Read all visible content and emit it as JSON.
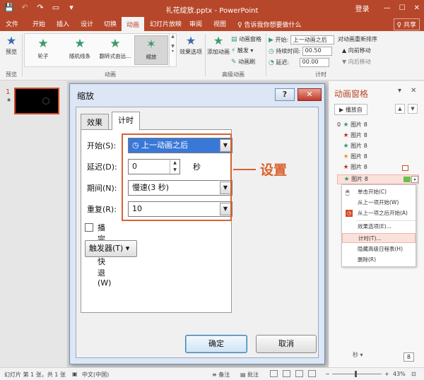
{
  "window": {
    "title": "礼花绽放.pptx - PowerPoint",
    "login": "登录",
    "min": "—",
    "max": "☐",
    "close": "✕",
    "qat": {
      "save": "💾",
      "undo": "↶",
      "redo": "↷",
      "present": "▭",
      "more": "▾"
    }
  },
  "tabs": {
    "file": "文件",
    "home": "开始",
    "insert": "插入",
    "design": "设计",
    "transitions": "切换",
    "animations": "动画",
    "slideshow": "幻灯片放映",
    "review": "审阅",
    "view": "视图",
    "tellme": "♀ 告诉我你想要做什么",
    "share": "♀ 共享"
  },
  "ribbon": {
    "preview_label": "预览",
    "preview_group": "预览",
    "animation_group": "动画",
    "advanced_group": "高级动画",
    "timing_group": "计时",
    "gallery": [
      {
        "label": "轮子"
      },
      {
        "label": "随机线条"
      },
      {
        "label": "翻转式由远..."
      },
      {
        "label": "缩放"
      }
    ],
    "effect_options": "效果选项",
    "add_animation": "添加动画",
    "anim_pane": "动画窗格",
    "trigger": "触发 ▾",
    "anim_painter": "动画刷",
    "start_label": "开始:",
    "start_value": "上一动画之后",
    "duration_label": "持续时间:",
    "duration_value": "00.50",
    "delay_label": "延迟:",
    "delay_value": "00.00",
    "reorder_title": "对动画重新排序",
    "move_earlier": "▲ 向前移动",
    "move_later": "▼ 向后移动"
  },
  "slidepane": {
    "num": "1",
    "star": "★"
  },
  "animpane": {
    "title": "动画窗格",
    "play": "▶ 播放自",
    "up": "▲",
    "down": "▼",
    "items": [
      {
        "num": "0",
        "label": "图片 8",
        "color": "#3a9a6a"
      },
      {
        "num": "",
        "label": "图片 8",
        "color": "#c0392b"
      },
      {
        "num": "",
        "label": "图片 8",
        "color": "#3a9a6a"
      },
      {
        "num": "",
        "label": "图片 8",
        "color": "#e0a030"
      },
      {
        "num": "",
        "label": "图片 8",
        "color": "#c0392b"
      },
      {
        "num": "",
        "label": "图片 8",
        "color": "#3a9a6a"
      }
    ],
    "footer": "秒 ▾",
    "page": "8"
  },
  "context_menu": {
    "on_click": "单击开始(C)",
    "with_previous": "从上一项开始(W)",
    "after_previous": "从上一项之后开始(A)",
    "effect_options": "效果选项(E)...",
    "timing": "计时(T)...",
    "hide_timeline": "隐藏高级日程表(H)",
    "remove": "删除(R)"
  },
  "dialog": {
    "title": "缩放",
    "help": "?",
    "close": "✕",
    "tab_effect": "效果",
    "tab_timing": "计时",
    "start_label": "开始(S):",
    "start_value": "上一动画之后",
    "delay_label": "延迟(D):",
    "delay_value": "0",
    "delay_unit": "秒",
    "duration_label": "期间(N):",
    "duration_value": "慢速(3 秒)",
    "repeat_label": "重复(R):",
    "repeat_value": "10",
    "rewind_label": "播完后快退(W)",
    "trigger_label": "触发器(T) ▾",
    "ok": "确定",
    "cancel": "取消"
  },
  "annotation": {
    "text": "设置",
    "color": "#d9622e"
  },
  "statusbar": {
    "slide_info": "幻灯片 第 1 张，共 1 张",
    "language": "中文(中国)",
    "notes": "备注",
    "comments": "批注",
    "zoom_minus": "−",
    "zoom_plus": "+",
    "zoom": "43%"
  },
  "colors": {
    "accent": "#b7472a",
    "dialog_bg": "#dce6f4",
    "selection": "#3a78d8"
  }
}
